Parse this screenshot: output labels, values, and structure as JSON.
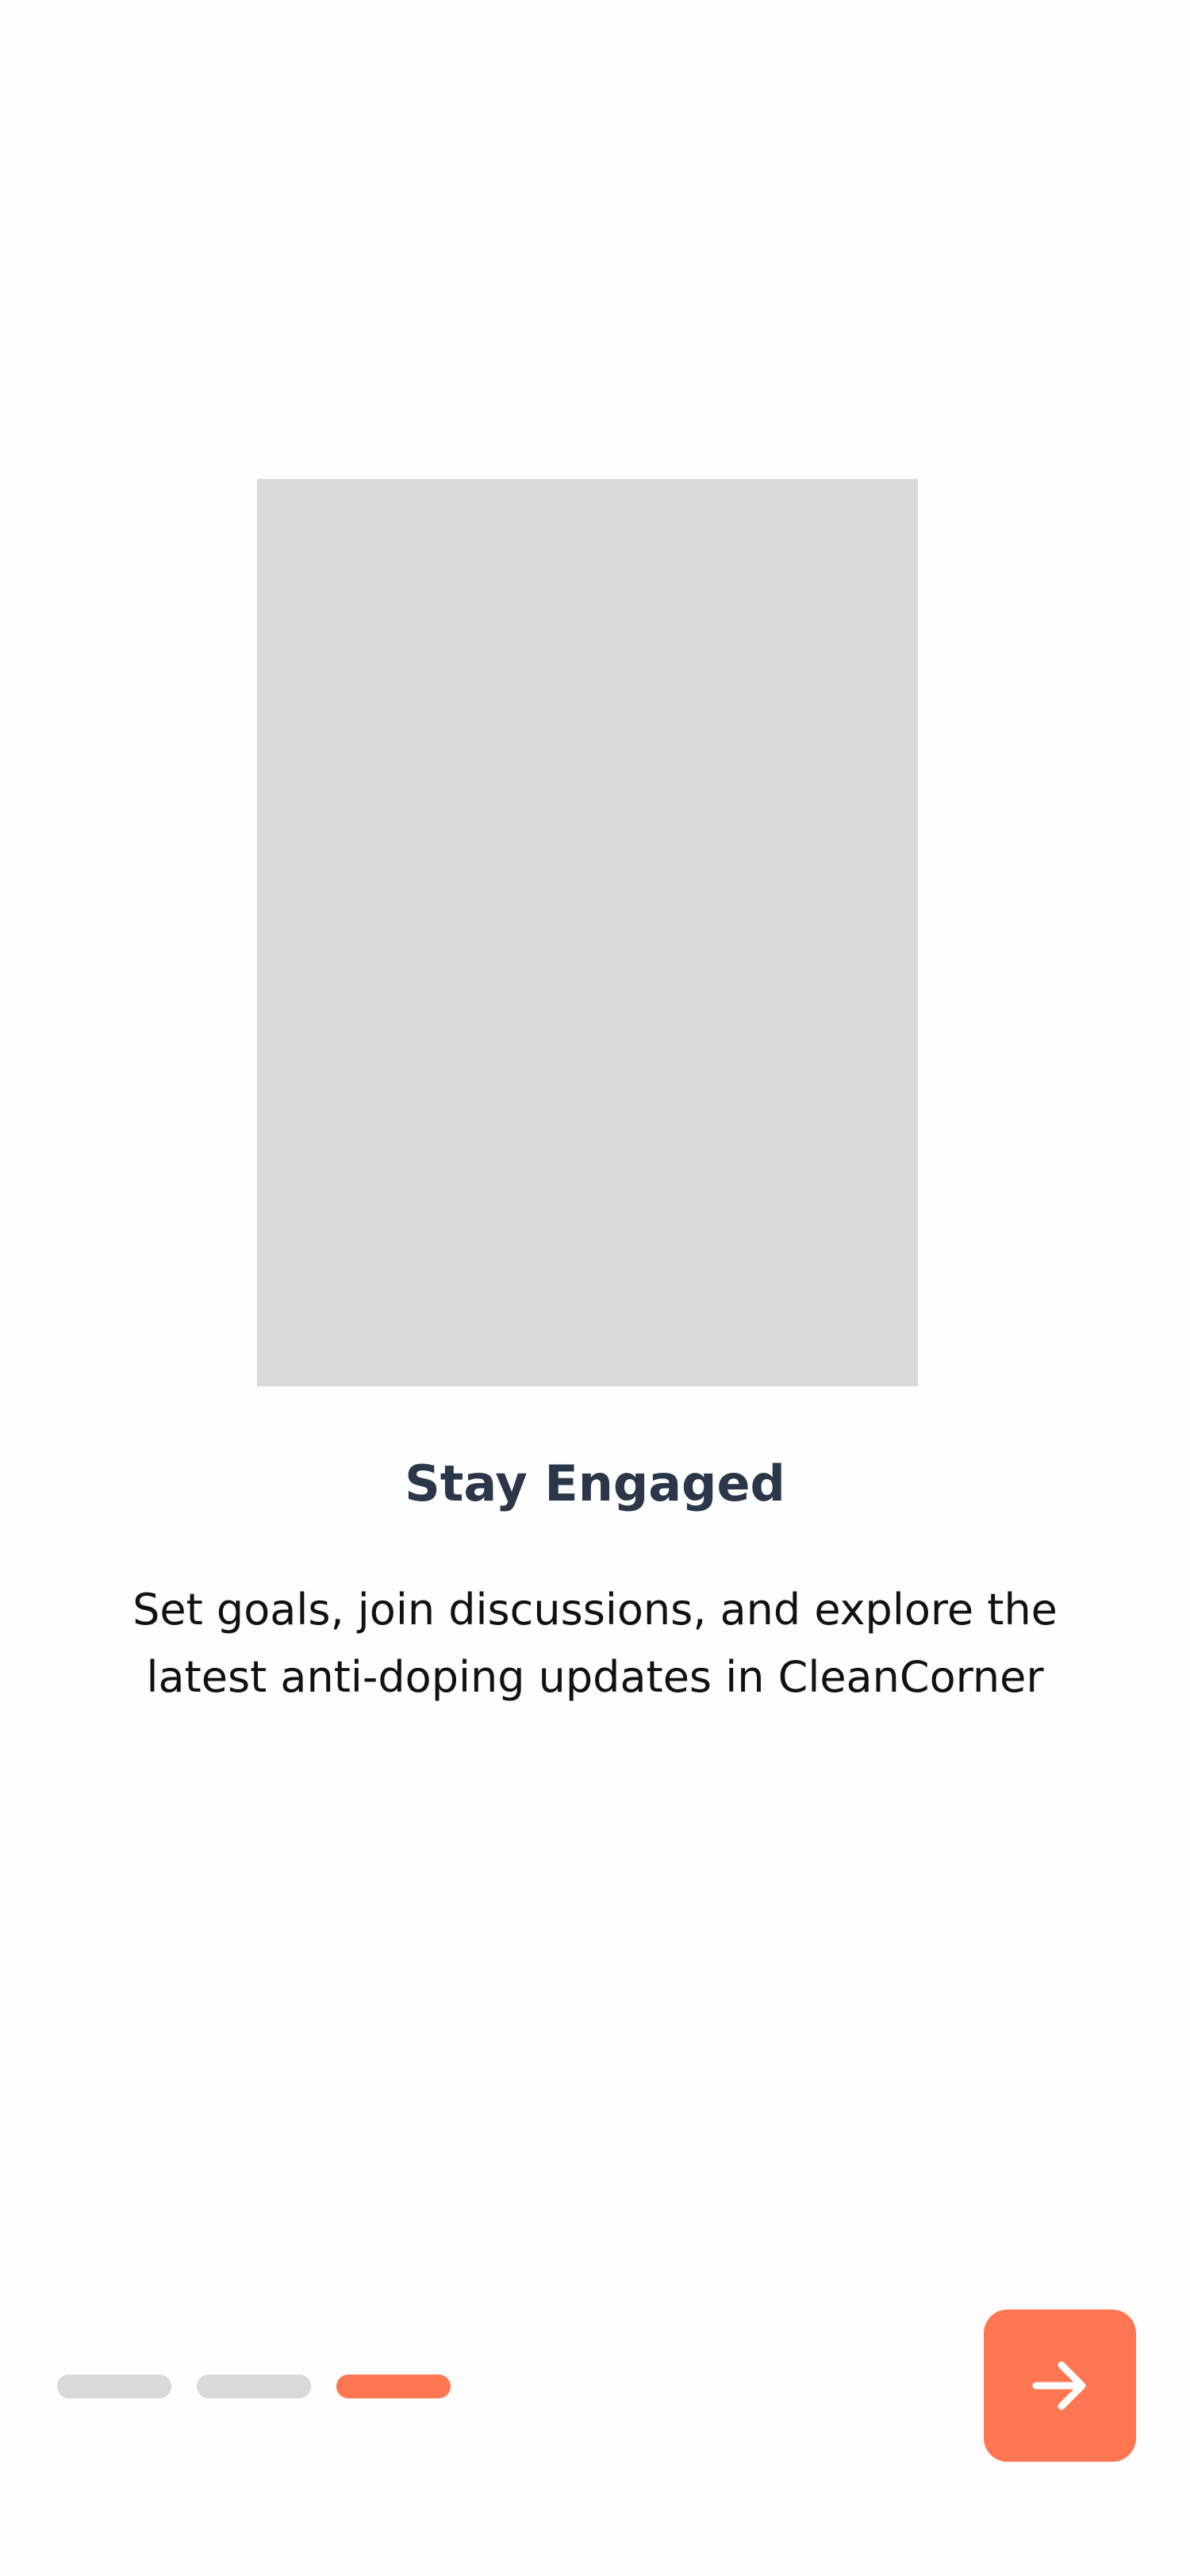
{
  "onboarding": {
    "title": "Stay Engaged",
    "description": "Set goals, join discussions, and explore the latest anti-doping updates in CleanCorner",
    "pages_total": 3,
    "current_page": 3,
    "next_icon": "arrow-right-icon"
  },
  "colors": {
    "accent": "#ff7652",
    "title": "#2b3648",
    "placeholder": "#d9d9d9",
    "indicator_inactive": "#d9d9d9"
  }
}
